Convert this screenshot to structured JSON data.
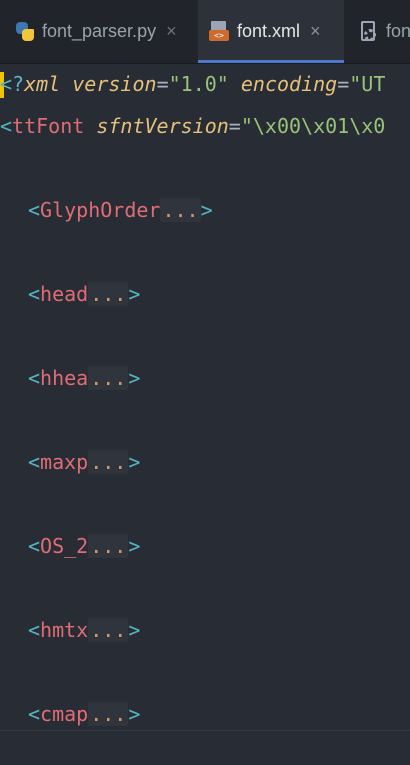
{
  "tabs": [
    {
      "label": "font_parser.py",
      "icon": "python-file-icon",
      "close": "×"
    },
    {
      "label": "font.xml",
      "icon": "xml-file-icon",
      "close": "×",
      "active": true
    },
    {
      "label": "fon",
      "icon": "config-file-icon"
    }
  ],
  "code": {
    "line1": {
      "open": "<?",
      "name": "xml",
      "attr1": "version",
      "eq1": "=",
      "val1": "\"1.0\"",
      "attr2": "encoding",
      "eq2": "=",
      "val2": "\"UT"
    },
    "line2": {
      "open": "<",
      "name": "ttFont",
      "attr": "sfntVersion",
      "eq": "=",
      "val": "\"\\x00\\x01\\x0"
    },
    "elements": [
      {
        "open": "<",
        "name": "GlyphOrder",
        "fold": "...",
        "close": ">"
      },
      {
        "open": "<",
        "name": "head",
        "fold": "...",
        "close": ">"
      },
      {
        "open": "<",
        "name": "hhea",
        "fold": "...",
        "close": ">"
      },
      {
        "open": "<",
        "name": "maxp",
        "fold": "...",
        "close": ">"
      },
      {
        "open": "<",
        "name": "OS_2",
        "fold": "...",
        "close": ">"
      },
      {
        "open": "<",
        "name": "hmtx",
        "fold": "...",
        "close": ">"
      },
      {
        "open": "<",
        "name": "cmap",
        "fold": "...",
        "close": ">"
      }
    ]
  },
  "colors": {
    "background": "#282c34",
    "tag": "#56b6c2",
    "element_name": "#e06c75",
    "attribute": "#e5c07b",
    "string": "#98c379",
    "caret": "#f0c400",
    "active_tab_underline": "#4d78cc"
  }
}
